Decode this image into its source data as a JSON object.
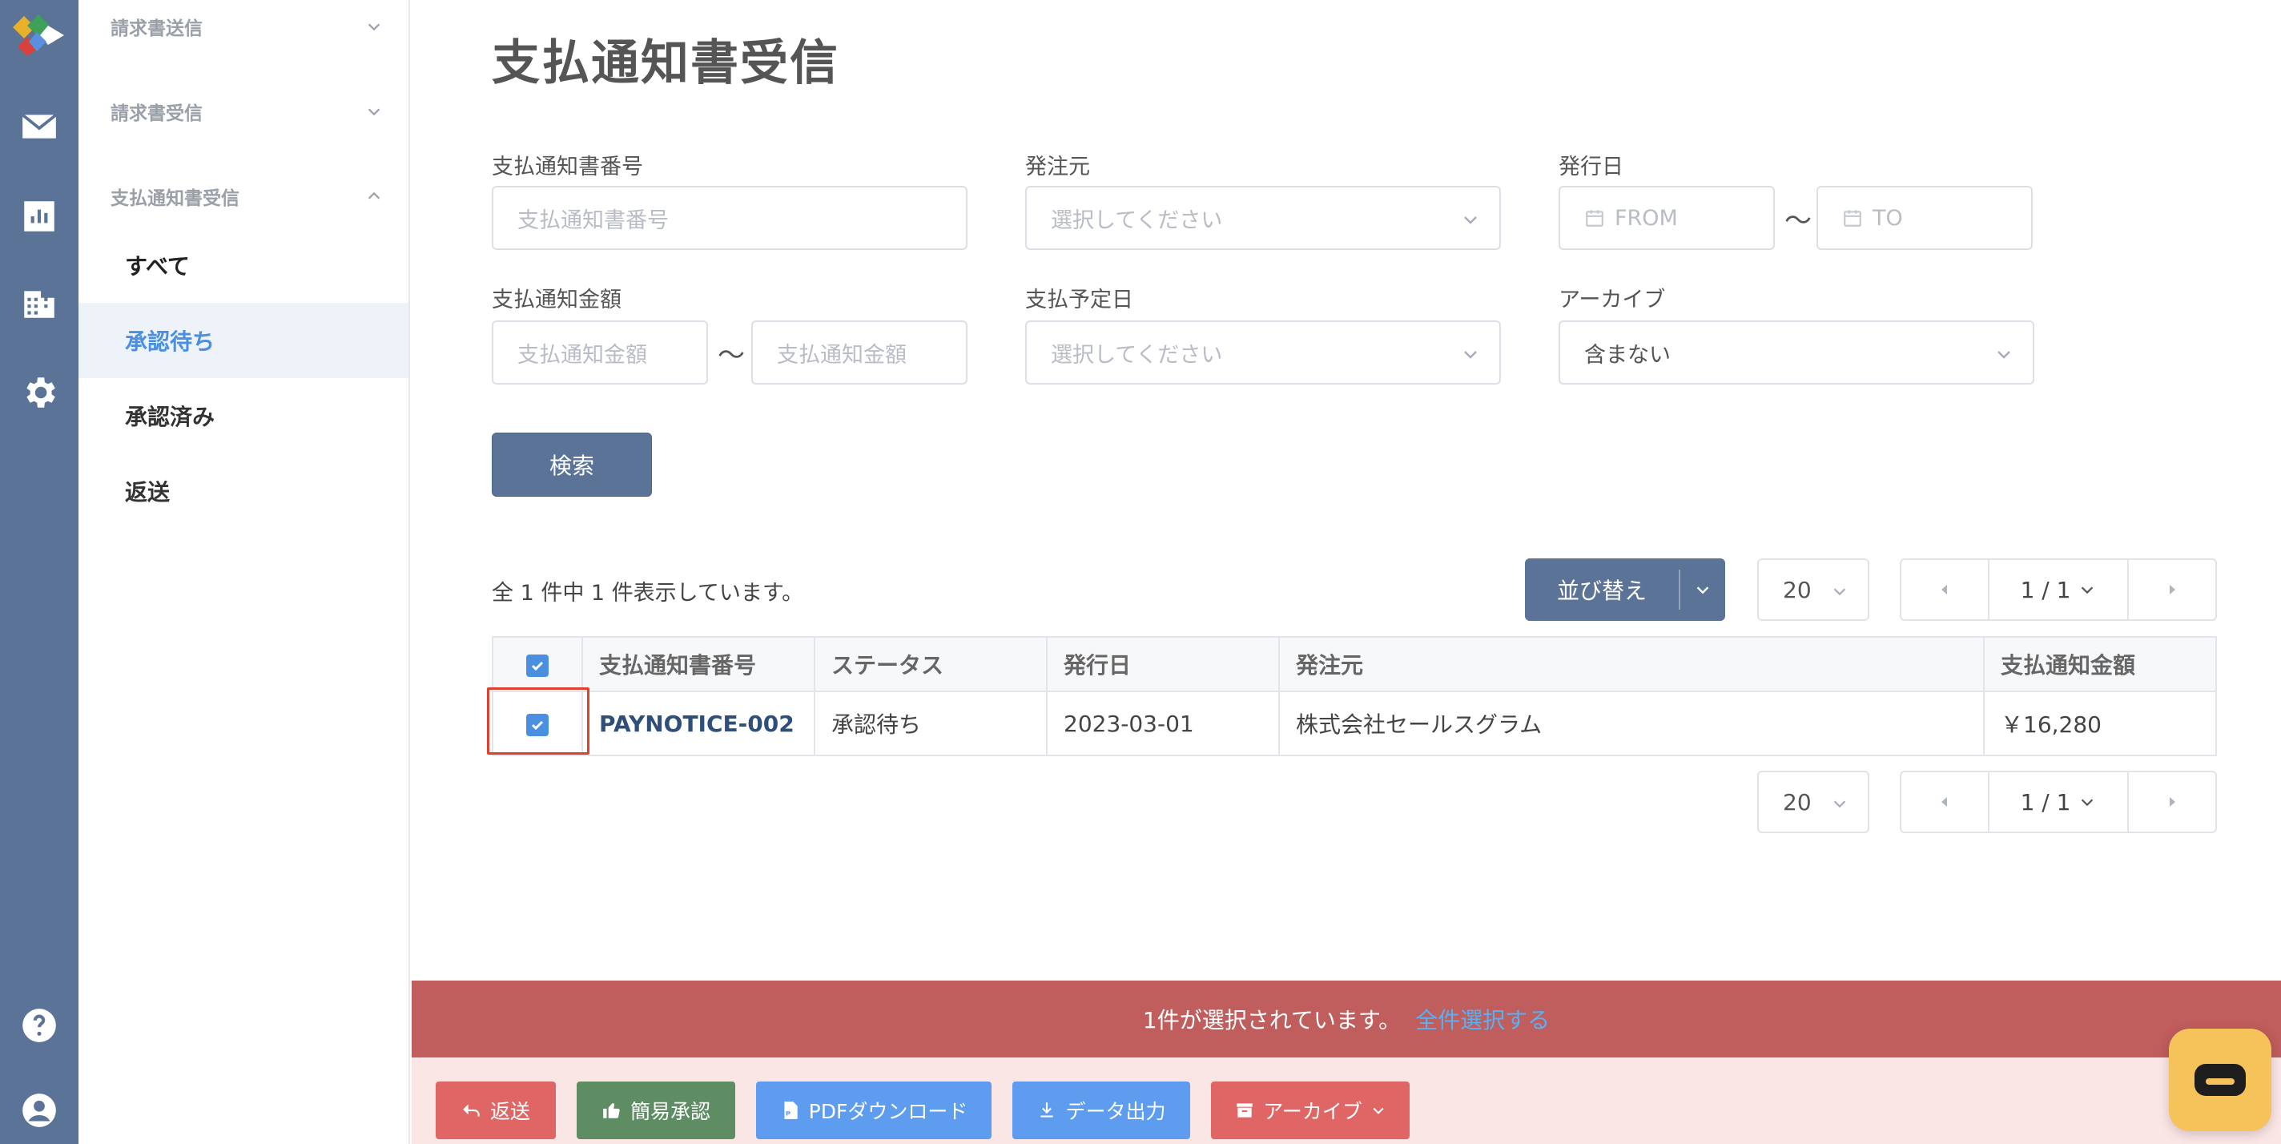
{
  "sidebar": {
    "groups": [
      {
        "label": "請求書送信"
      },
      {
        "label": "請求書受信"
      },
      {
        "label": "支払通知書受信"
      }
    ],
    "items": [
      {
        "label": "すべて"
      },
      {
        "label": "承認待ち"
      },
      {
        "label": "承認済み"
      },
      {
        "label": "返送"
      }
    ]
  },
  "page": {
    "title": "支払通知書受信"
  },
  "filters": {
    "number": {
      "label": "支払通知書番号",
      "placeholder": "支払通知書番号"
    },
    "client": {
      "label": "発注元",
      "placeholder": "選択してください"
    },
    "issue_date": {
      "label": "発行日",
      "from_placeholder": "FROM",
      "to_placeholder": "TO"
    },
    "amount": {
      "label": "支払通知金額",
      "min_placeholder": "支払通知金額",
      "max_placeholder": "支払通知金額"
    },
    "due_date": {
      "label": "支払予定日",
      "placeholder": "選択してください"
    },
    "archive": {
      "label": "アーカイブ",
      "value": "含まない"
    },
    "tilde": "〜",
    "search_label": "検索"
  },
  "results": {
    "summary": "全 1 件中 1 件表示しています。",
    "sort_label": "並び替え",
    "per_page": "20",
    "page_indicator": "1 / 1"
  },
  "table": {
    "headers": [
      "支払通知書番号",
      "ステータス",
      "発行日",
      "発注元",
      "支払通知金額"
    ],
    "rows": [
      {
        "number": "PAYNOTICE-002",
        "status": "承認待ち",
        "issue_date": "2023-03-01",
        "client": "株式会社セールスグラム",
        "amount": "￥16,280"
      }
    ]
  },
  "selection": {
    "text": "1件が選択されています。",
    "select_all": "全件選択する"
  },
  "actions": {
    "return": "返送",
    "quick_approve": "簡易承認",
    "pdf_download": "PDFダウンロード",
    "data_export": "データ出力",
    "archive": "アーカイブ"
  },
  "colors": {
    "rail": "#5a7396",
    "accent": "#4a8fe0",
    "selection_bar": "#c05d5d",
    "btn_return": "#e06666",
    "btn_approve": "#5e8c63",
    "btn_pdf": "#5e9cf0",
    "btn_export": "#5e9cf0",
    "btn_archive": "#e06666",
    "chat": "#f6c35b"
  }
}
